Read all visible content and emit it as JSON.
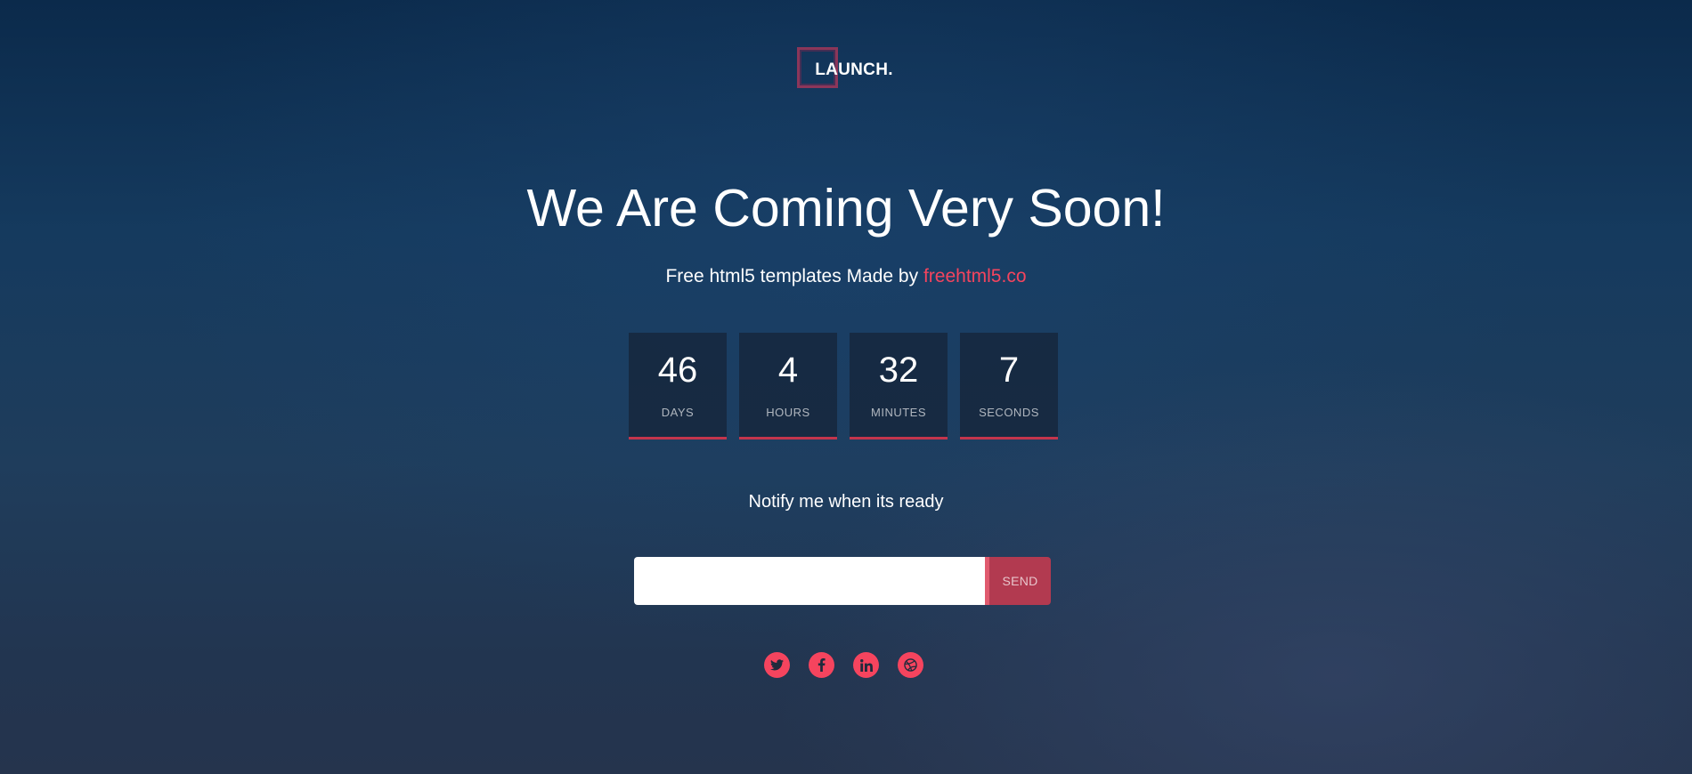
{
  "brand": {
    "logo_text": "LAUNCH."
  },
  "hero": {
    "headline": "We Are Coming Very Soon!",
    "subline_text": "Free html5 templates Made by ",
    "subline_link": "freehtml5.co"
  },
  "countdown": [
    {
      "value": "46",
      "label": "DAYS"
    },
    {
      "value": "4",
      "label": "HOURS"
    },
    {
      "value": "32",
      "label": "MINUTES"
    },
    {
      "value": "7",
      "label": "SECONDS"
    }
  ],
  "notify": {
    "heading": "Notify me when its ready",
    "email_value": "",
    "email_placeholder": "",
    "send_label": "SEND"
  },
  "social": [
    {
      "icon": "twitter-icon"
    },
    {
      "icon": "facebook-icon"
    },
    {
      "icon": "linkedin-icon"
    },
    {
      "icon": "dribbble-icon"
    }
  ],
  "colors": {
    "accent": "#f5445e",
    "send_button": "#b23a50",
    "background_top": "#0b2a4b",
    "background_bottom": "#25344d"
  }
}
